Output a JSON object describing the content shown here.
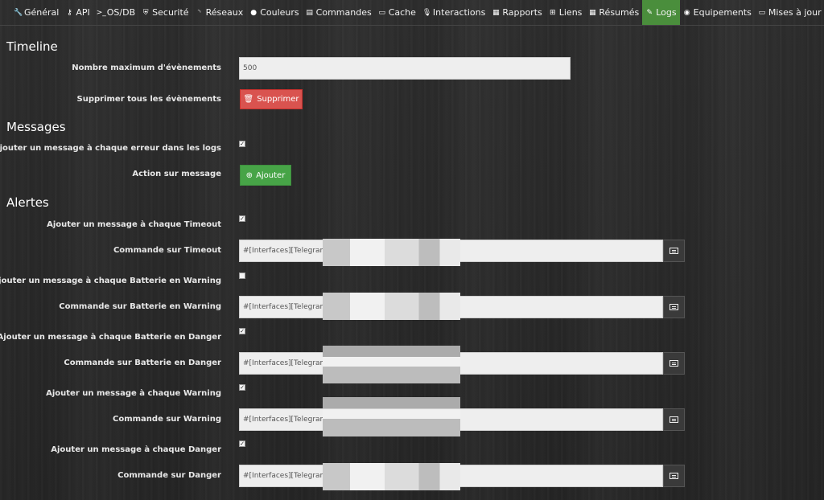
{
  "tabs": [
    {
      "label": "Général",
      "icon": "wrench-icon",
      "glyph": "🔧",
      "active": false
    },
    {
      "label": "API",
      "icon": "key-icon",
      "glyph": "⚷",
      "active": false
    },
    {
      "label": "OS/DB",
      "icon": "terminal-icon",
      "glyph": ">_",
      "active": false
    },
    {
      "label": "Securité",
      "icon": "shield-icon",
      "glyph": "⛨",
      "active": false
    },
    {
      "label": "Réseaux",
      "icon": "rss-icon",
      "glyph": "◝",
      "active": false
    },
    {
      "label": "Couleurs",
      "icon": "tint-icon",
      "glyph": "●",
      "active": false
    },
    {
      "label": "Commandes",
      "icon": "list-icon",
      "glyph": "▤",
      "active": false
    },
    {
      "label": "Cache",
      "icon": "hdd-icon",
      "glyph": "▭",
      "active": false
    },
    {
      "label": "Interactions",
      "icon": "microphone-icon",
      "glyph": "🎙",
      "active": false
    },
    {
      "label": "Rapports",
      "icon": "newspaper-icon",
      "glyph": "▦",
      "active": false
    },
    {
      "label": "Liens",
      "icon": "sitemap-icon",
      "glyph": "⊞",
      "active": false
    },
    {
      "label": "Résumés",
      "icon": "table-icon",
      "glyph": "▦",
      "active": false
    },
    {
      "label": "Logs",
      "icon": "edit-icon",
      "glyph": "✎",
      "active": true
    },
    {
      "label": "Equipements",
      "icon": "globe-icon",
      "glyph": "◉",
      "active": false
    },
    {
      "label": "Mises à jour",
      "icon": "credit-card-icon",
      "glyph": "▭",
      "active": false
    }
  ],
  "timeline": {
    "title": "Timeline",
    "max_events_label": "Nombre maximum d'évènements",
    "max_events_value": "500",
    "delete_all_label": "Supprimer tous les évènements",
    "delete_button": "Supprimer"
  },
  "messages": {
    "title": "Messages",
    "add_on_error_label": "Ajouter un message à chaque erreur dans les logs",
    "add_on_error_checked": true,
    "action_label": "Action sur message",
    "add_button": "Ajouter"
  },
  "alertes": {
    "title": "Alertes",
    "rows": [
      {
        "check_label": "Ajouter un message à chaque Timeout",
        "checked": true,
        "cmd_label": "Commande sur Timeout",
        "cmd_value": "#[Interfaces][Telegram"
      },
      {
        "check_label": "Ajouter un message à chaque Batterie en Warning",
        "checked": false,
        "cmd_label": "Commande sur Batterie en Warning",
        "cmd_value": "#[Interfaces][Telegram"
      },
      {
        "check_label": "Ajouter un message à chaque Batterie en Danger",
        "checked": true,
        "cmd_label": "Commande sur Batterie en Danger",
        "cmd_value": "#[Interfaces][Telegram"
      },
      {
        "check_label": "Ajouter un message à chaque Warning",
        "checked": true,
        "cmd_label": "Commande sur Warning",
        "cmd_value": "#[Interfaces][Telegram"
      },
      {
        "check_label": "Ajouter un message à chaque Danger",
        "checked": true,
        "cmd_label": "Commande sur Danger",
        "cmd_value": "#[Interfaces][Telegram"
      }
    ]
  },
  "colors": {
    "active_tab": "#4a8e3c",
    "danger": "#d9534f",
    "success": "#47a447"
  }
}
